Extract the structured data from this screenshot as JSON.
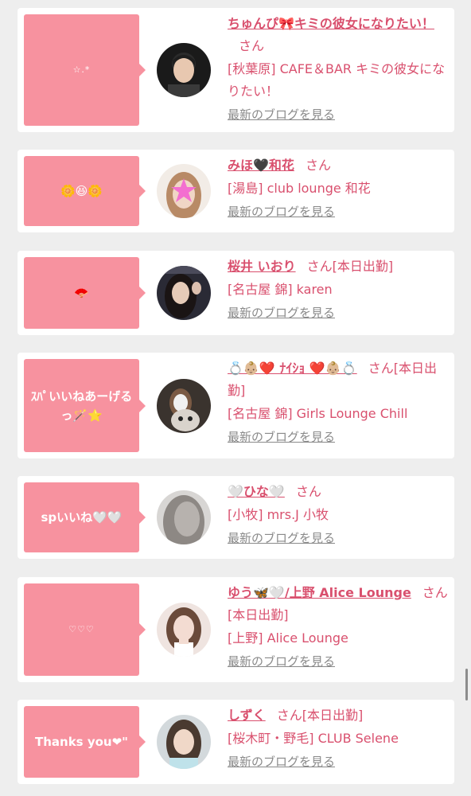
{
  "cards": [
    {
      "bubble": "☆.*",
      "name": "ちゅんぴ🎀キミの彼女になりたい！",
      "honorific": "さん",
      "tag": "",
      "shop": "[秋葉原] CAFE＆BAR キミの彼女になりたい！",
      "blog_link": "最新のブログを見る"
    },
    {
      "bubble": "🌼😆🌼",
      "name": "みほ🖤和花",
      "honorific": "さん",
      "tag": "",
      "shop": "[湯島] club lounge 和花",
      "blog_link": "最新のブログを見る"
    },
    {
      "bubble": "🪭",
      "name": "桜井 いおり",
      "honorific": "さん",
      "tag": "[本日出勤]",
      "shop": "[名古屋 錦] karen",
      "blog_link": "最新のブログを見る"
    },
    {
      "bubble": "ｽﾊﾟいいねあーげるっ🪄⭐️",
      "name": "💍👶🏼❤️ ﾅｲｼｮ ❤️👶🏼💍",
      "honorific": "さん",
      "tag": "[本日出勤]",
      "shop": "[名古屋 錦] Girls Lounge Chill",
      "blog_link": "最新のブログを見る"
    },
    {
      "bubble": "spいいね🤍🤍",
      "name": "🤍ひな🤍",
      "honorific": "さん",
      "tag": "",
      "shop": "[小牧] mrs.J 小牧",
      "blog_link": "最新のブログを見る"
    },
    {
      "bubble": "♡♡♡",
      "name": "ゆう🦋🤍/上野 Alice Lounge",
      "honorific": "さん",
      "tag": "[本日出勤]",
      "shop": "[上野] Alice Lounge",
      "blog_link": "最新のブログを見る"
    },
    {
      "bubble": "Thanks you❤\"",
      "name": "しずく",
      "honorific": "さん",
      "tag": "[本日出勤]",
      "shop": "[桜木町・野毛] CLUB Selene",
      "blog_link": "最新のブログを見る"
    }
  ],
  "colors": {
    "accent": "#d9506e",
    "bubble": "#f7929f",
    "link_gray": "#8a8a8a",
    "background": "#eeeeee"
  }
}
